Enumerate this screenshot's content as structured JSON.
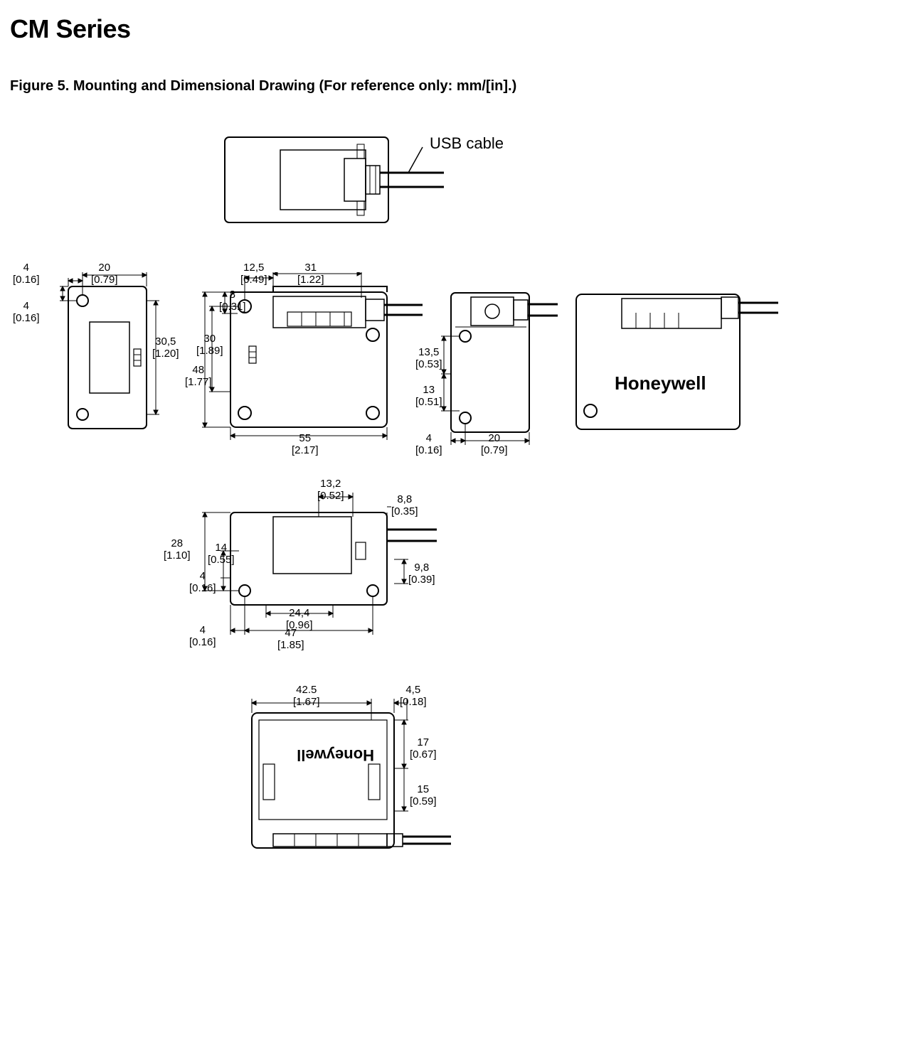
{
  "title": "CM Series",
  "figure_caption": "Figure 5. Mounting and Dimensional Drawing (For reference only: mm/[in].)",
  "callouts": {
    "usb_cable": "USB cable"
  },
  "brand": "Honeywell",
  "dimensions": {
    "left_side": {
      "d4a_mm": "4",
      "d4a_in": "[0.16]",
      "d20_mm": "20",
      "d20_in": "[0.79]",
      "d4b_mm": "4",
      "d4b_in": "[0.16]",
      "d30_5_mm": "30,5",
      "d30_5_in": "[1.20]"
    },
    "front": {
      "d12_5_mm": "12,5",
      "d12_5_in": "[0.49]",
      "d31_mm": "31",
      "d31_in": "[1.22]",
      "d8_mm": "8",
      "d8_in": "[0.31]",
      "d30_mm": "30",
      "d30_in": "[1.89]",
      "d48_mm": "48",
      "d48_in": "[1.77]",
      "d55_mm": "55",
      "d55_in": "[2.17]"
    },
    "right_side": {
      "d13_5_mm": "13,5",
      "d13_5_in": "[0.53]",
      "d13_mm": "13",
      "d13_in": "[0.51]",
      "d4_mm": "4",
      "d4_in": "[0.16]",
      "d20_mm": "20",
      "d20_in": "[0.79]"
    },
    "rear": {
      "d13_2_mm": "13,2",
      "d13_2_in": "[0.52]",
      "d8_8_mm": "8,8",
      "d8_8_in": "[0.35]",
      "d28_mm": "28",
      "d28_in": "[1.10]",
      "d14_mm": "14",
      "d14_in": "[0.55]",
      "d4a_mm": "4",
      "d4a_in": "[0.16]",
      "d9_8_mm": "9,8",
      "d9_8_in": "[0.39]",
      "d24_4_mm": "24,4",
      "d24_4_in": "[0.96]",
      "d4b_mm": "4",
      "d4b_in": "[0.16]",
      "d47_mm": "47",
      "d47_in": "[1.85]"
    },
    "bottom": {
      "d42_5_mm": "42.5",
      "d42_5_in": "[1.67]",
      "d4_5_mm": "4,5",
      "d4_5_in": "[0.18]",
      "d17_mm": "17",
      "d17_in": "[0.67]",
      "d15_mm": "15",
      "d15_in": "[0.59]"
    }
  }
}
